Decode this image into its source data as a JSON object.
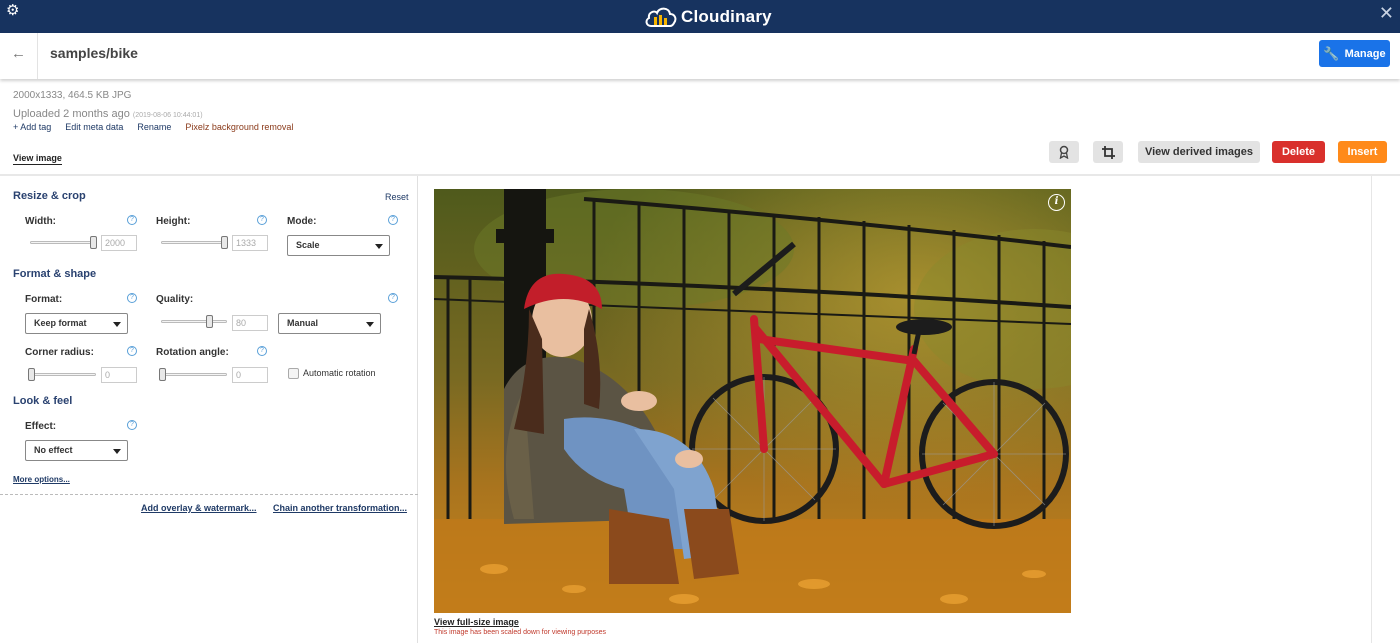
{
  "brand": {
    "name": "Cloudinary"
  },
  "header": {
    "title": "samples/bike",
    "manage_label": "Manage"
  },
  "meta": {
    "dimensions": "2000x1333, 464.5 KB JPG",
    "uploaded": "Uploaded 2 months ago",
    "timestamp": "(2019-08-06 10:44:01)",
    "actions": [
      "+ Add tag",
      "Edit meta data",
      "Rename",
      "Pixelz background removal"
    ]
  },
  "tabs": {
    "view_image": "View image"
  },
  "toolbar": {
    "derived": "View derived images",
    "delete": "Delete",
    "insert": "Insert"
  },
  "panel": {
    "resize_title": "Resize & crop",
    "reset": "Reset",
    "width_label": "Width:",
    "width_value": "2000",
    "height_label": "Height:",
    "height_value": "1333",
    "mode_label": "Mode:",
    "mode_value": "Scale",
    "format_title": "Format & shape",
    "format_label": "Format:",
    "format_value": "Keep format",
    "quality_label": "Quality:",
    "quality_value": "80",
    "quality_mode": "Manual",
    "corner_label": "Corner radius:",
    "corner_value": "0",
    "rotation_label": "Rotation angle:",
    "rotation_value": "0",
    "auto_rotation": "Automatic rotation",
    "look_title": "Look & feel",
    "effect_label": "Effect:",
    "effect_value": "No effect",
    "more_options": "More options...",
    "add_overlay": "Add overlay & watermark...",
    "chain": "Chain another transformation..."
  },
  "preview": {
    "view_full": "View full-size image",
    "note": "This image has been scaled down for viewing purposes"
  },
  "colors": {
    "brand_bar": "#17335f",
    "manage": "#1a73e8",
    "delete": "#d9302c",
    "insert": "#ff8a1a"
  }
}
